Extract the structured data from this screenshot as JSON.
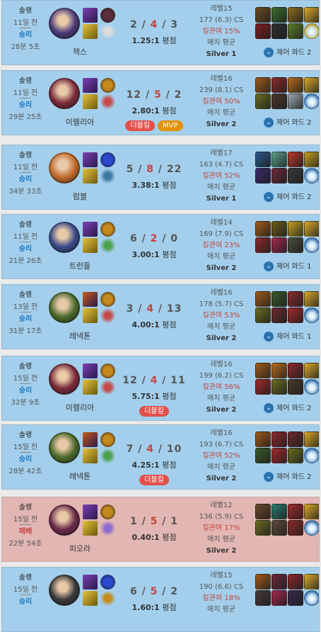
{
  "matches": [
    {
      "mode": "솔랭",
      "ago": "11일 전",
      "result": "승리",
      "duration": "28분 5초",
      "champion": "잭스",
      "k": "2",
      "d": "4",
      "a": "3",
      "ratio": "1.25:1",
      "ratio_suffix": "평점",
      "badges": [],
      "level": "레벨15",
      "cs": "177 (6.3) CS",
      "kp": "킬관여 15%",
      "avg_label": "매치 평균",
      "tier": "Silver 1",
      "ward_label": "제어 와드 2",
      "colors": {
        "portrait": "#4a3a78",
        "spell1": "#7d3fb5",
        "spell2": "#e7c23b",
        "rune1": "#5b2d3a",
        "rune2": "#dcdcdc"
      },
      "items": [
        "#6b4a1e",
        "#3b6c2e",
        "#8a6a20",
        "#d8a829",
        "#7e1f1f",
        "#2f2f2f",
        "#5a7d2a",
        "#c2a021"
      ],
      "loss": false
    },
    {
      "mode": "솔랭",
      "ago": "11일 전",
      "result": "승리",
      "duration": "29분 25초",
      "champion": "이렐리아",
      "k": "12",
      "d": "5",
      "a": "2",
      "ratio": "2.80:1",
      "ratio_suffix": "평점",
      "badges": [
        {
          "text": "더블킬",
          "kind": "dk"
        },
        {
          "text": "MVP",
          "kind": "mvp"
        }
      ],
      "level": "레벨16",
      "cs": "239 (8.1) CS",
      "kp": "킬관여 50%",
      "avg_label": "매치 평균",
      "tier": "Silver 2",
      "ward_label": "제어 와드 2",
      "colors": {
        "portrait": "#7a2a3a",
        "spell1": "#7d3fb5",
        "spell2": "#e7c23b",
        "rune1": "#c58a1d",
        "rune2": "#c44a4a"
      },
      "items": [
        "#a05a1a",
        "#8a2a2a",
        "#b56a20",
        "#d8a829",
        "#6a6a22",
        "#4a3a2a",
        "#9aa7b4",
        "#2a6aaa"
      ],
      "loss": false
    },
    {
      "mode": "솔랭",
      "ago": "11일 전",
      "result": "승리",
      "duration": "34분 33초",
      "champion": "럼블",
      "k": "5",
      "d": "8",
      "a": "22",
      "ratio": "3.38:1",
      "ratio_suffix": "평점",
      "badges": [],
      "level": "레벨17",
      "cs": "163 (4.7) CS",
      "kp": "킬관여 52%",
      "avg_label": "매치 평균",
      "tier": "Silver 1",
      "ward_label": "제어 와드 2",
      "colors": {
        "portrait": "#c06a2a",
        "spell1": "#7d3fb5",
        "spell2": "#e7c23b",
        "rune1": "#2a4ad0",
        "rune2": "#3a7aa0"
      },
      "items": [
        "#2a5a8a",
        "#5aa08a",
        "#b53a2a",
        "#c2a021",
        "#3a2a6a",
        "#6a2a3a",
        "#3a3a3a",
        "#2a6aaa"
      ],
      "loss": false
    },
    {
      "mode": "솔랭",
      "ago": "11일 전",
      "result": "승리",
      "duration": "21분 26초",
      "champion": "트런들",
      "k": "6",
      "d": "2",
      "a": "0",
      "ratio": "3.00:1",
      "ratio_suffix": "평점",
      "badges": [],
      "level": "레벨14",
      "cs": "169 (7.9) CS",
      "kp": "킬관여 23%",
      "avg_label": "매치 평균",
      "tier": "Silver 2",
      "ward_label": "제어 와드 1",
      "colors": {
        "portrait": "#3a4a8a",
        "spell1": "#7d3fb5",
        "spell2": "#e7c23b",
        "rune1": "#c58a1d",
        "rune2": "#4aa04a"
      },
      "items": [
        "#a05a1a",
        "#6a5a1a",
        "#c2a021",
        "#d8a829",
        "#8a2a2a",
        "#a02a4a",
        "#4a4a3a",
        "#2a6aaa"
      ],
      "loss": false
    },
    {
      "mode": "솔랭",
      "ago": "13일 전",
      "result": "승리",
      "duration": "31분 17초",
      "champion": "레넥톤",
      "k": "3",
      "d": "4",
      "a": "13",
      "ratio": "4.00:1",
      "ratio_suffix": "평점",
      "badges": [],
      "level": "레벨16",
      "cs": "178 (5.7) CS",
      "kp": "킬관여 53%",
      "avg_label": "매치 평균",
      "tier": "Silver 2",
      "ward_label": "제어 와드 1",
      "colors": {
        "portrait": "#4a6a2a",
        "spell1": "#c85a1a",
        "spell2": "#e7c23b",
        "rune1": "#c58a1d",
        "rune2": "#c44a4a"
      },
      "items": [
        "#a05a1a",
        "#3a5a2a",
        "#8a2a2a",
        "#d8a829",
        "#6a6a22",
        "#6a2a2a",
        "#a02a2a",
        "#2a6aaa"
      ],
      "loss": false
    },
    {
      "mode": "솔랭",
      "ago": "15일 전",
      "result": "승리",
      "duration": "32분 9초",
      "champion": "이렐리아",
      "k": "12",
      "d": "4",
      "a": "11",
      "ratio": "5.75:1",
      "ratio_suffix": "평점",
      "badges": [
        {
          "text": "더블킬",
          "kind": "dk"
        }
      ],
      "level": "레벨16",
      "cs": "199 (6.2) CS",
      "kp": "킬관여 56%",
      "avg_label": "매치 평균",
      "tier": "Silver 2",
      "ward_label": "제어 와드 2",
      "colors": {
        "portrait": "#7a2a3a",
        "spell1": "#7d3fb5",
        "spell2": "#e7c23b",
        "rune1": "#c58a1d",
        "rune2": "#c44a4a"
      },
      "items": [
        "#a05a1a",
        "#b56a20",
        "#8a2a2a",
        "#d8a829",
        "#a02a2a",
        "#6a6a22",
        "#4a3a2a",
        "#2a6aaa"
      ],
      "loss": false
    },
    {
      "mode": "솔랭",
      "ago": "15일 전",
      "result": "승리",
      "duration": "28분 42초",
      "champion": "레넥톤",
      "k": "7",
      "d": "4",
      "a": "10",
      "ratio": "4.25:1",
      "ratio_suffix": "평점",
      "badges": [
        {
          "text": "더블킬",
          "kind": "dk"
        }
      ],
      "level": "레벨16",
      "cs": "193 (6.7) CS",
      "kp": "킬관여 52%",
      "avg_label": "매치 평균",
      "tier": "Silver 2",
      "ward_label": "제어 와드 2",
      "colors": {
        "portrait": "#4a6a2a",
        "spell1": "#c85a1a",
        "spell2": "#e7c23b",
        "rune1": "#c58a1d",
        "rune2": "#4aa04a"
      },
      "items": [
        "#a05a1a",
        "#8a2a2a",
        "#6a2a2a",
        "#d8a829",
        "#3a5a2a",
        "#a02a2a",
        "#6a6a22",
        "#2a6aaa"
      ],
      "loss": false
    },
    {
      "mode": "솔랭",
      "ago": "15일 전",
      "result": "패배",
      "duration": "22분 54초",
      "champion": "피오라",
      "k": "1",
      "d": "5",
      "a": "1",
      "ratio": "0.40:1",
      "ratio_suffix": "평점",
      "badges": [],
      "level": "레벨12",
      "cs": "136 (5.9) CS",
      "kp": "킬관여 17%",
      "avg_label": "매치 평균",
      "tier": "Silver 2",
      "ward_label": "",
      "colors": {
        "portrait": "#6a2a4a",
        "spell1": "#7d3fb5",
        "spell2": "#e7c23b",
        "rune1": "#c58a1d",
        "rune2": "#8a6ad0"
      },
      "items": [
        "#6a4a2a",
        "#2a7a6a",
        "#a02a2a",
        "#d8a829",
        "#6a6a22",
        "#5a4a3a",
        "#8a2a2a",
        "#2a6aaa"
      ],
      "loss": true
    },
    {
      "mode": "솔랭",
      "ago": "15일 전",
      "result": "승리",
      "duration": "",
      "champion": "",
      "k": "6",
      "d": "5",
      "a": "2",
      "ratio": "1.60:1",
      "ratio_suffix": "평점",
      "badges": [],
      "level": "레벨15",
      "cs": "190 (6.6) CS",
      "kp": "킬관여 18%",
      "avg_label": "매치 평균",
      "tier": "",
      "ward_label": "",
      "colors": {
        "portrait": "#3a3a3a",
        "spell1": "#7d3fb5",
        "spell2": "#e7c23b",
        "rune1": "#2a4ad0",
        "rune2": "#c58a1d"
      },
      "items": [
        "#a05a1a",
        "#6a2a3a",
        "#8a2a2a",
        "#d8a829",
        "#4a3a3a",
        "#a02a4a",
        "#3a2a4a",
        "#2a6aaa"
      ],
      "loss": false
    }
  ]
}
